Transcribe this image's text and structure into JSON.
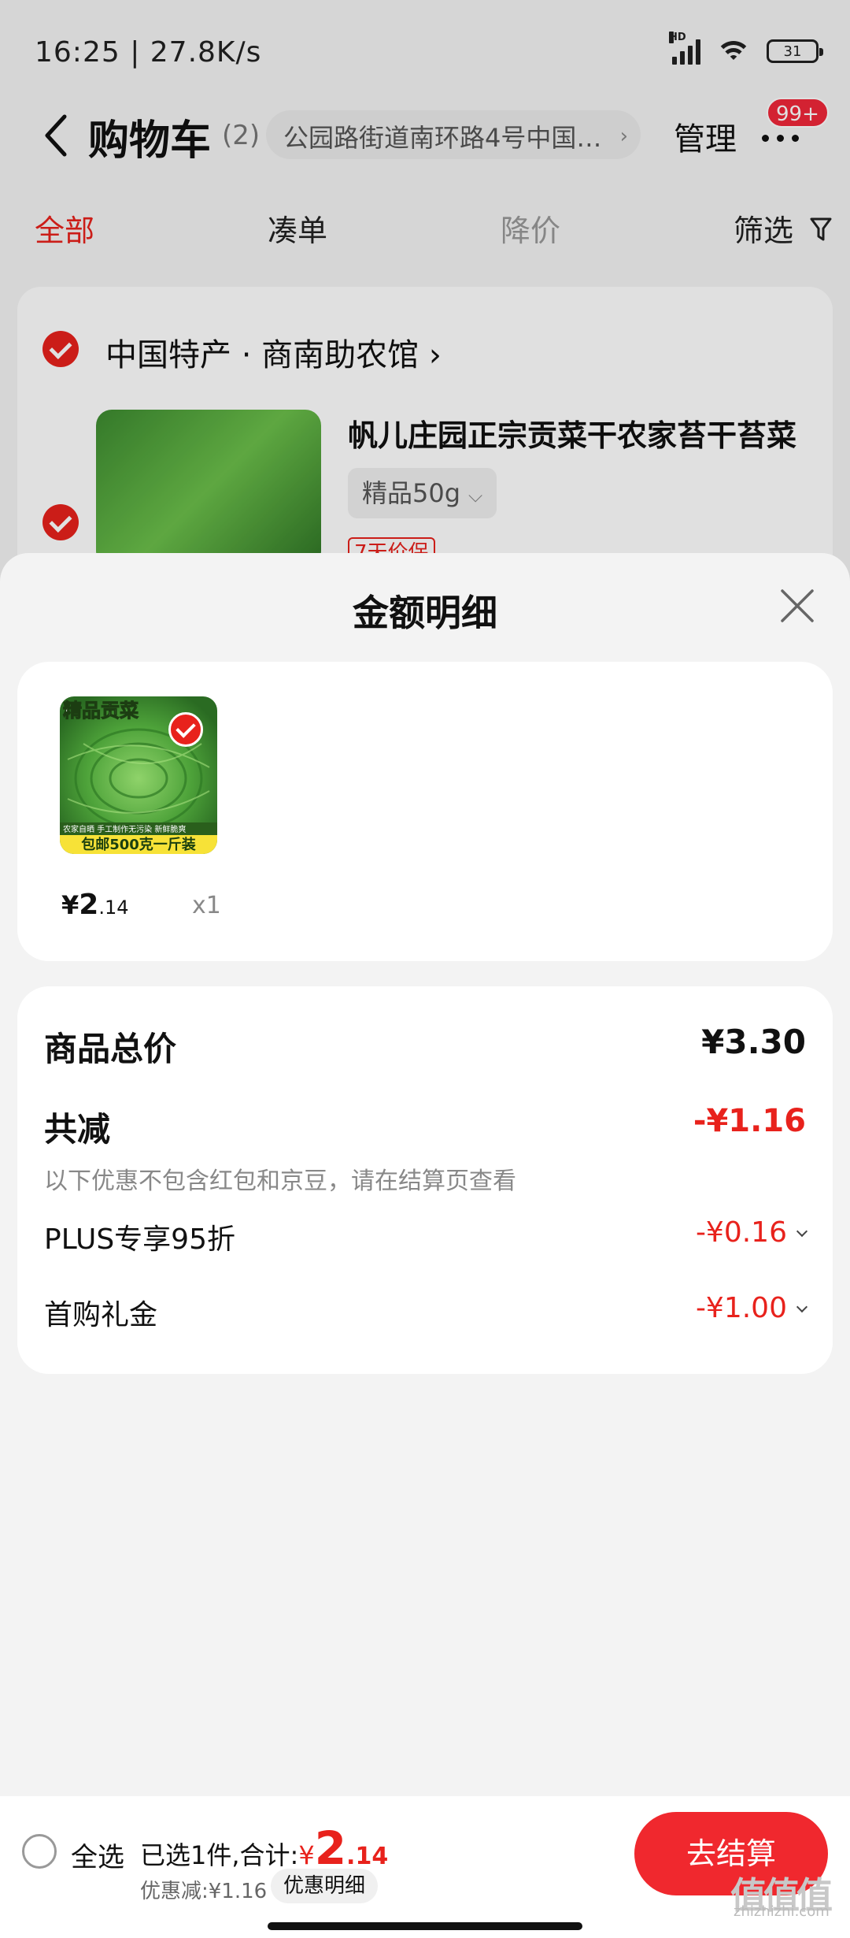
{
  "status_bar": {
    "time_speed": "16:25 | 27.8K/s",
    "hd": "HD",
    "battery": "31"
  },
  "nav": {
    "title": "购物车",
    "count": "(2)",
    "address": "公园路街道南环路4号中国…",
    "manage": "管理",
    "badge": "99+"
  },
  "tabs": [
    {
      "label": "全部",
      "active": true
    },
    {
      "label": "凑单",
      "active": false
    },
    {
      "label": "降价",
      "active": false
    },
    {
      "label": "筛选",
      "active": false
    }
  ],
  "store": {
    "name": "中国特产 · 商南助农馆",
    "product_title": "帆儿庄园正宗贡菜干农家苔干苔菜",
    "spec": "精品50g",
    "tag": "7天价保"
  },
  "sheet": {
    "title": "金额明细",
    "item": {
      "thumb_top_text": "精品贡菜",
      "thumb_small_text": "农家自晒 手工制作无污染 新鲜脆爽",
      "thumb_bottom_text": "包邮500克一斤装",
      "price_yen": "¥",
      "price_int": "2",
      "price_dec": ".14",
      "qty": "x1"
    },
    "summary": {
      "total_label": "商品总价",
      "total_value": "¥3.30",
      "reduce_label": "共减",
      "reduce_value": "-¥1.16",
      "note": "以下优惠不包含红包和京豆，请在结算页查看",
      "plus_label": "PLUS专享95折",
      "plus_value": "-¥0.16",
      "gift_label": "首购礼金",
      "gift_value": "-¥1.00"
    }
  },
  "bottom_bar": {
    "select_all": "全选",
    "selected_prefix": "已选1件,合计:",
    "total_yen": "¥",
    "total_int": "2",
    "total_dec": ".14",
    "saved": "优惠减:¥1.16",
    "detail_btn": "优惠明细",
    "checkout": "去结算"
  },
  "watermark": "zhizhizhi.com",
  "colors": {
    "accent": "#e8221c",
    "checkout": "#f0282e"
  }
}
